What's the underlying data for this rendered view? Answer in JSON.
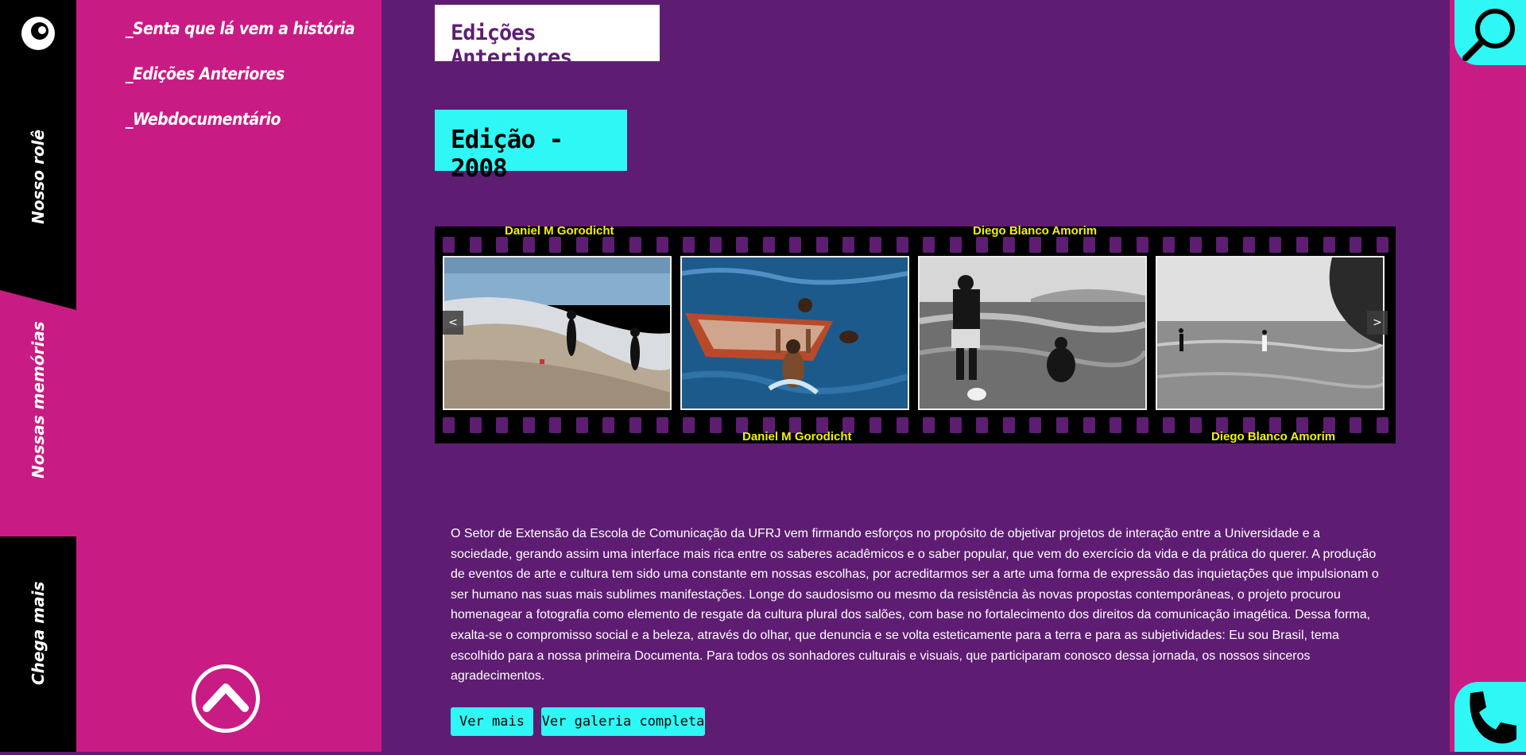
{
  "rail": {
    "items": [
      "Nosso rolê",
      "Nossas memórias",
      "Chega mais"
    ]
  },
  "menu": {
    "items": [
      "_Senta que lá vem a história",
      "_Edições Anteriores",
      "_Webdocumentário"
    ]
  },
  "main": {
    "page_title": "Edições Anteriores",
    "edition_title": "Edição - 2008",
    "carousel": {
      "captions_top": [
        "Daniel M Gorodicht",
        "Diego Blanco Amorim"
      ],
      "captions_bottom": [
        "Daniel M Gorodicht",
        "Diego Blanco Amorim"
      ],
      "prev": "<",
      "next": ">"
    },
    "description": "O Setor de Extensão da Escola de Comunicação da UFRJ vem firmando esforços no propósito de objetivar projetos de interação entre a Universidade e a sociedade, gerando assim uma interface mais rica entre os saberes acadêmicos e o saber popular, que vem do exercício da vida e da prática do querer. A produção de eventos de arte e cultura tem sido uma constante em nossas escolhas, por acreditarmos ser a arte uma forma de expressão das inquietações que impulsionam o ser humano nas suas mais sublimes manifestações. Longe do saudosismo ou mesmo da resistência às novas propostas contemporâneas, o projeto procurou homenagear a fotografia como elemento de resgate da cultura plural dos salões, com base no fortalecimento dos direitos da comunicação imagética. Dessa forma, exalta-se o compromisso social e a beleza, através do olhar, que denuncia e se volta esteticamente para a terra e para as subjetividades: Eu sou Brasil, tema escolhido para a nossa primeira Documenta. Para todos os sonhadores culturais e visuais, que participaram conosco dessa jornada, os nossos sinceros agradecimentos.",
    "buttons": {
      "ver_mais": "Ver mais",
      "ver_galeria": "Ver galeria completa"
    }
  },
  "colors": {
    "purple": "#5e1d73",
    "pink": "#c91b84",
    "cyan": "#2ef7f5",
    "caption_yellow": "#f2f200"
  },
  "icons": [
    "logo-icon",
    "search-icon",
    "phone-icon",
    "scroll-up-icon"
  ]
}
